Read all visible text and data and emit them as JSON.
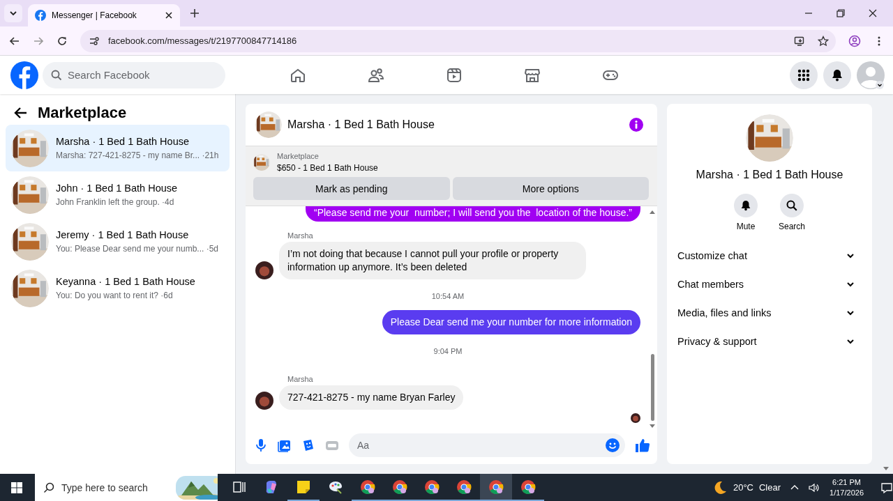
{
  "browser": {
    "tab_title": "Messenger | Facebook",
    "url": "facebook.com/messages/t/2197700847714186"
  },
  "header": {
    "search": {
      "placeholder": "Search Facebook"
    },
    "nav": [
      {
        "kind": "home"
      },
      {
        "kind": "friends"
      },
      {
        "kind": "video"
      },
      {
        "kind": "store"
      },
      {
        "kind": "gaming"
      }
    ]
  },
  "sidebar": {
    "title": "Marketplace",
    "threads": [
      {
        "name": "Marsha · 1 Bed 1 Bath House",
        "preview": "Marsha: 727-421-8275 - my name Br... ·21h",
        "selected": true
      },
      {
        "name": "John · 1 Bed 1 Bath House",
        "preview": "John Franklin left the group. ·4d",
        "selected": false
      },
      {
        "name": "Jeremy · 1 Bed 1 Bath House",
        "preview": "You: Please Dear send me your numb... ·5d",
        "selected": false
      },
      {
        "name": "Keyanna · 1 Bed 1 Bath House",
        "preview": "You: Do you want to rent it? ·6d",
        "selected": false
      }
    ]
  },
  "chat": {
    "title": "Marsha · 1 Bed 1 Bath House",
    "listing": {
      "label": "Marketplace",
      "title": "$650 - 1 Bed 1 Bath House",
      "buttons": [
        "Mark as pending",
        "More options"
      ]
    },
    "messages": [
      {
        "kind": "outgoing",
        "text": "“Please send me your  number; I will send you the  location of the house.”",
        "color": "#a100f2"
      },
      {
        "kind": "incoming",
        "sender": "Marsha",
        "text": "I’m not doing that because I cannot pull your profile or property information up anymore. It’s been deleted"
      },
      {
        "kind": "timestamp",
        "text": "10:54 AM"
      },
      {
        "kind": "outgoing",
        "text": "Please Dear send me your number for more information",
        "color": "#5a3cf0"
      },
      {
        "kind": "timestamp",
        "text": "9:04 PM"
      },
      {
        "kind": "incoming",
        "sender": "Marsha",
        "text": "727-421-8275 - my name Bryan Farley"
      }
    ],
    "composer": {
      "placeholder": "Aa"
    }
  },
  "details": {
    "title": "Marsha · 1 Bed 1 Bath House",
    "actions": [
      {
        "kind": "mute",
        "label": "Mute"
      },
      {
        "kind": "search",
        "label": "Search"
      }
    ],
    "sections": [
      {
        "label": "Customize chat",
        "expanded": false
      },
      {
        "label": "Chat members",
        "expanded": false
      },
      {
        "label": "Media, files and links",
        "expanded": false
      },
      {
        "label": "Privacy & support",
        "expanded": false
      }
    ]
  },
  "taskbar": {
    "search": {
      "placeholder": "Type here to search"
    },
    "apps": [
      {
        "kind": "taskview",
        "running": false,
        "selected": false
      },
      {
        "kind": "copilot",
        "running": false,
        "selected": false
      },
      {
        "kind": "notes",
        "running": true,
        "selected": false
      },
      {
        "kind": "paint",
        "running": false,
        "selected": false
      },
      {
        "kind": "chrome",
        "running": true,
        "selected": false
      },
      {
        "kind": "chrome",
        "running": true,
        "selected": false
      },
      {
        "kind": "chrome",
        "running": true,
        "selected": false
      },
      {
        "kind": "chrome",
        "running": true,
        "selected": false
      },
      {
        "kind": "chrome",
        "running": true,
        "selected": true
      },
      {
        "kind": "chrome",
        "running": true,
        "selected": false
      }
    ],
    "temperature": "20°C",
    "weather": "Clear",
    "time": "6:21 PM",
    "date": "1/17/2026"
  }
}
